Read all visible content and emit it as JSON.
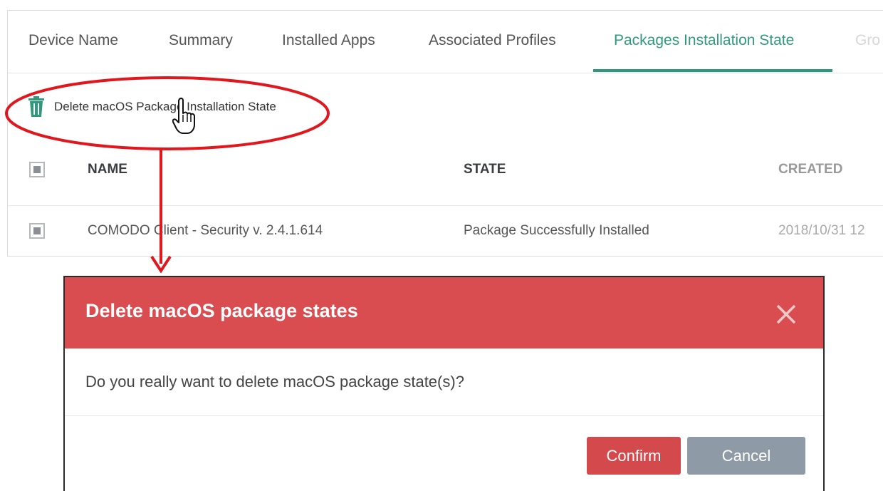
{
  "tabs": [
    {
      "label": "Device Name"
    },
    {
      "label": "Summary"
    },
    {
      "label": "Installed Apps"
    },
    {
      "label": "Associated Profiles"
    },
    {
      "label": "Packages Installation State"
    },
    {
      "label": "Gro"
    }
  ],
  "active_tab": "Packages Installation State",
  "toolbar": {
    "delete_label": "Delete macOS Package Installation State",
    "icon": "trash-icon"
  },
  "table": {
    "columns": [
      "NAME",
      "STATE",
      "CREATED"
    ],
    "rows": [
      {
        "name": "COMODO Client - Security v. 2.4.1.614",
        "state": "Package Successfully Installed",
        "created": "2018/10/31 12"
      }
    ]
  },
  "dialog": {
    "title": "Delete macOS package states",
    "message": "Do you really want to delete macOS package state(s)?",
    "confirm_label": "Confirm",
    "cancel_label": "Cancel",
    "header_color": "#d94c4f"
  },
  "colors": {
    "accent": "#2f9a7b",
    "annotation": "#e0181e",
    "confirm": "#d44a4c",
    "cancel": "#8e9aa6"
  }
}
